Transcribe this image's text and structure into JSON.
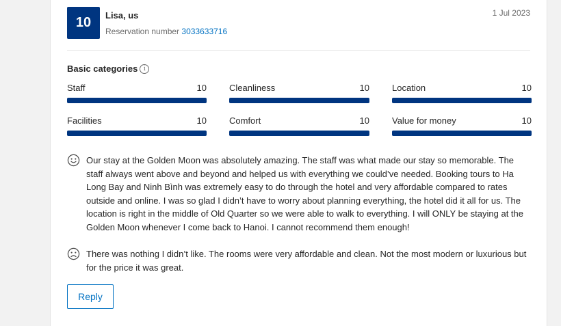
{
  "review": {
    "score": "10",
    "reviewer": "Lisa, us",
    "reservation_label": "Reservation number",
    "reservation_number": "3033633716",
    "date": "1 Jul 2023"
  },
  "categories": {
    "title": "Basic categories",
    "items": [
      {
        "label": "Staff",
        "score": "10",
        "fill": 1.0
      },
      {
        "label": "Cleanliness",
        "score": "10",
        "fill": 1.0
      },
      {
        "label": "Location",
        "score": "10",
        "fill": 1.0
      },
      {
        "label": "Facilities",
        "score": "10",
        "fill": 1.0
      },
      {
        "label": "Comfort",
        "score": "10",
        "fill": 1.0
      },
      {
        "label": "Value for money",
        "score": "10",
        "fill": 1.0
      }
    ]
  },
  "positive": "Our stay at the Golden Moon was absolutely amazing. The staff was what made our stay so memorable. The staff always went above and beyond and helped us with everything we could’ve needed. Booking tours to Ha Long Bay and Ninh Bình was extremely easy to do through the hotel and very affordable compared to rates outside and online. I was so glad I didn’t have to worry about planning everything, the hotel did it all for us. The location is right in the middle of Old Quarter so we were able to walk to everything. I will ONLY be staying at the Golden Moon whenever I come back to Hanoi. I cannot recommend them enough!",
  "negative": "There was nothing I didn’t like. The rooms were very affordable and clean. Not the most modern or luxurious but for the price it was great.",
  "reply_label": "Reply",
  "colors": {
    "score_bg": "#003580",
    "link": "#0071c2",
    "bar": "#003580"
  }
}
